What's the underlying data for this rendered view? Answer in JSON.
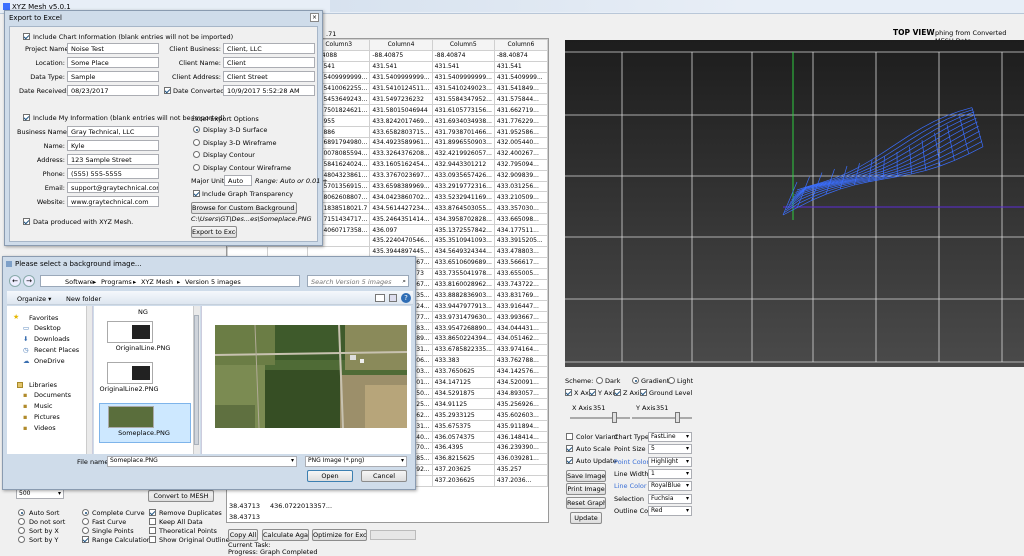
{
  "main_window": {
    "title": "XYZ Mesh v5.0.1",
    "top_view_title": "TOP VIEW",
    "top_view_subtitle": "phing from Converted MESH Data",
    "grid_header": [
      "Column3",
      "Column4",
      "Column5",
      "Column6"
    ],
    "grid_partial_header": ".71",
    "grid_rows": [
      [
        "-88.4088",
        "-88.40875",
        "-88.40874",
        "-88.40874"
      ],
      [
        "431.541",
        "431.541",
        "431.541",
        "431.541"
      ],
      [
        "431.5409999999...",
        "431.5409999999...",
        "431.5409999999...",
        "431.5409999..."
      ],
      [
        "431.5410062255...",
        "431.5410124511...",
        "431.5410249023...",
        "431.541849..."
      ],
      [
        "431.5453649243...",
        "431.5497236232",
        "431.5584347952...",
        "431.575844..."
      ],
      [
        "431.7501824621...",
        "431.58015046944",
        "431.6105773156...",
        "431.662719..."
      ],
      [
        "435.955",
        "433.8242017469...",
        "431.6934034938...",
        "431.776229..."
      ],
      [
        "435.886",
        "433.6582803715...",
        "431.7938701466...",
        "431.952586..."
      ],
      [
        "434.6891794980...",
        "434.4923589961...",
        "431.8996550903...",
        "432.005440..."
      ],
      [
        "434.0078085594...",
        "433.3264376208...",
        "432.4219926057...",
        "432.400267..."
      ],
      [
        "433.5841624024...",
        "433.1605162454...",
        "432.9443301212",
        "432.795094..."
      ],
      [
        "433.4804323861...",
        "433.3767023697...",
        "433.0935657426...",
        "432.909839..."
      ],
      [
        "433.5701356915...",
        "433.6598389969...",
        "433.2919772316...",
        "433.031256..."
      ],
      [
        "433.8062608807...",
        "434.0423860702...",
        "433.5232941169...",
        "433.210509..."
      ],
      [
        "434.1838518021.7",
        "434.5614427234...",
        "433.8764503055...",
        "433.357030..."
      ],
      [
        "434.7151434717...",
        "435.2464351414...",
        "434.3958702828...",
        "433.665098..."
      ],
      [
        "435.4060717358...",
        "436.097",
        "435.1372557842...",
        "434.177511..."
      ],
      [
        "435.2240470546...",
        "435.3510941093...",
        "433.3915205..."
      ],
      [
        "435.3944897445...",
        "434.5649324344...",
        "433.478803..."
      ],
      [
        "434.0227753567...",
        "433.6510609689...",
        "433.566617..."
      ],
      [
        "433.8791397773",
        "433.7355041978...",
        "433.655005..."
      ],
      [
        "433.8475713367...",
        "433.8160028962...",
        "433.743722..."
      ],
      [
        "433.8679275135...",
        "433.8882836903...",
        "433.831769..."
      ],
      [
        "433.9063626524...",
        "433.9447977913...",
        "433.916447..."
      ],
      [
        "433.9397553077...",
        "433.9731479630...",
        "433.993667..."
      ],
      [
        "433.9472410983...",
        "433.9547268890...",
        "434.044431..."
      ],
      [
        "433.9061317689...",
        "433.8650224394...",
        "434.051462..."
      ],
      [
        "433.7659485431...",
        "433.6785822335...",
        "433.974164..."
      ],
      [
        "433.5876785006...",
        "433.383",
        "433.762788..."
      ],
      [
        "433.6763705003...",
        "433.7650625",
        "434.142576..."
      ],
      [
        "434.9117477501...",
        "434.147125",
        "434.520091..."
      ],
      [
        "434.2204676250...",
        "434.5291875",
        "434.893057..."
      ],
      [
        "434.5658588125...",
        "434.91125",
        "435.256926..."
      ],
      [
        "434.9295856562...",
        "435.2933125",
        "435.602603..."
      ],
      [
        "435.3024802631...",
        "435.675375",
        "435.911894..."
      ],
      [
        "435.6799589140...",
        "436.0574375",
        "436.148414..."
      ],
      [
        "435.0597294570...",
        "436.4395",
        "436.239390..."
      ],
      [
        "436.4406459785...",
        "436.8215625",
        "436.039281..."
      ],
      [
        "436.8221354892...",
        "437.203625",
        "435.257"
      ],
      [
        "437.2036625",
        "437.2036..."
      ]
    ],
    "left_partial_rows": [
      {
        "a": "38.43713",
        "b": "436.0722013357..."
      },
      {
        "a": "38.43713",
        "b": "436.4539688025..."
      }
    ],
    "sort_options": [
      "Auto Sort",
      "Do not sort",
      "Sort by X",
      "Sort by Y"
    ],
    "sort_selected": "Auto Sort",
    "curve_options": [
      {
        "label": "Complete Curve",
        "selected": true
      },
      {
        "label": "Fast Curve",
        "selected": false
      },
      {
        "label": "Single Points",
        "selected": false
      },
      {
        "label": "Range Calculations",
        "selected": true,
        "check": true
      }
    ],
    "data_options": [
      {
        "label": "Remove Duplicates",
        "checked": true
      },
      {
        "label": "Keep All Data",
        "checked": false
      },
      {
        "label": "Theoretical Points",
        "checked": false
      },
      {
        "label": "Show Original Outline",
        "checked": false
      }
    ],
    "convert_button": "Convert to MESH",
    "combo_partial": "500",
    "bottom_buttons": [
      "Copy All",
      "Calculate Again",
      "Optimize for Excel"
    ],
    "current_task_label": "Current Task:",
    "progress_text": "Progress: Graph Completed",
    "scheme_label": "Scheme:",
    "scheme_options": [
      "Dark",
      "Gradient",
      "Light"
    ],
    "scheme_selected": "Gradient",
    "axis_checks": [
      "X Axis",
      "Y Axis",
      "Z Axis",
      "Ground Level"
    ],
    "x_axis_label": "X Axis",
    "x_axis_value": "351",
    "y_axis_label": "Y Axis",
    "y_axis_value": "351",
    "color_checks": [
      {
        "label": "Color Variant",
        "checked": false
      },
      {
        "label": "Auto Scale",
        "checked": true
      },
      {
        "label": "Auto Update",
        "checked": true
      }
    ],
    "side_buttons": [
      "Save Image",
      "Print Image",
      "Reset Graph",
      "Update"
    ],
    "chart_props": [
      {
        "label": "Chart Type",
        "value": "FastLine",
        "blue": false
      },
      {
        "label": "Point Size",
        "value": "5",
        "blue": false
      },
      {
        "label": "Point Color",
        "value": "Highlight",
        "blue": true
      },
      {
        "label": "Line Width",
        "value": "1",
        "blue": false
      },
      {
        "label": "Line Color",
        "value": "RoyalBlue",
        "blue": true
      },
      {
        "label": "Selection",
        "value": "Fuchsia",
        "blue": false
      },
      {
        "label": "Outline Color",
        "value": "Red",
        "blue": false
      }
    ],
    "chart_bg_color": "#1a1a1a",
    "mesh_color": "#3b6fff"
  },
  "excel_dialog": {
    "title": "Export to Excel",
    "include_chart_info": "Include Chart Information (blank entries will not be imported)",
    "project_name_label": "Project Name:",
    "project_name": "Noise Test",
    "location_label": "Location:",
    "location": "Some Place",
    "data_type_label": "Data Type:",
    "data_type": "Sample",
    "date_received_label": "Date Received:",
    "date_received": "08/23/2017",
    "client_business_label": "Client Business:",
    "client_business": "Client, LLC",
    "client_name_label": "Client Name:",
    "client_name": "Client",
    "client_address_label": "Client Address:",
    "client_address": "Client Street",
    "date_converted_label": "Date Converted:",
    "date_converted": "10/9/2017 5:52:28 AM",
    "include_my_info": "Include My Information (blank entries will not be imported)",
    "business_name_label": "Business Name:",
    "business_name": "Gray Technical, LLC",
    "name_label": "Name:",
    "name": "Kyle",
    "address_label": "Address:",
    "address": "123 Sample Street",
    "phone_label": "Phone:",
    "phone": "(555) 555-5555",
    "email_label": "Email:",
    "email": "support@graytechnical.com",
    "website_label": "Website:",
    "website": "www.graytechnical.com",
    "produced_with": "Data produced with XYZ Mesh.",
    "export_options_title": "Excel Export Options",
    "display_options": [
      "Display 3-D Surface",
      "Display 3-D Wireframe",
      "Display Contour",
      "Display Contour Wireframe"
    ],
    "display_selected": "Display 3-D Surface",
    "major_units_label": "Major Units",
    "major_units": "Auto",
    "range_hint": "Range: Auto or 0.01 +",
    "include_transparency": "Include Graph Transparency",
    "browse_button": "Browse for Custom Background Image",
    "bg_path": "C:\\Users\\GT\\Des...es\\Someplace.PNG",
    "export_button": "Export to Excel"
  },
  "file_dialog": {
    "title": "Please select a background image...",
    "breadcrumb": [
      "Software",
      "Programs",
      "XYZ Mesh",
      "Version 5 images"
    ],
    "search_placeholder": "Search Version 5 images",
    "organize_label": "Organize ▾",
    "new_folder_label": "New folder",
    "favorites_header": "Favorites",
    "favorites": [
      "Desktop",
      "Downloads",
      "Recent Places",
      "OneDrive"
    ],
    "libraries_header": "Libraries",
    "libraries": [
      "Documents",
      "Music",
      "Pictures",
      "Videos"
    ],
    "files": [
      {
        "label": "NG",
        "selected": false
      },
      {
        "label": "OriginalLine.PNG",
        "selected": false
      },
      {
        "label": "OriginalLine2.PNG",
        "selected": false
      },
      {
        "label": "Someplace.PNG",
        "selected": true
      }
    ],
    "file_name_label": "File name:",
    "file_name_value": "Someplace.PNG",
    "file_type_value": "PNG Image (*.png)",
    "open_button": "Open",
    "cancel_button": "Cancel"
  }
}
